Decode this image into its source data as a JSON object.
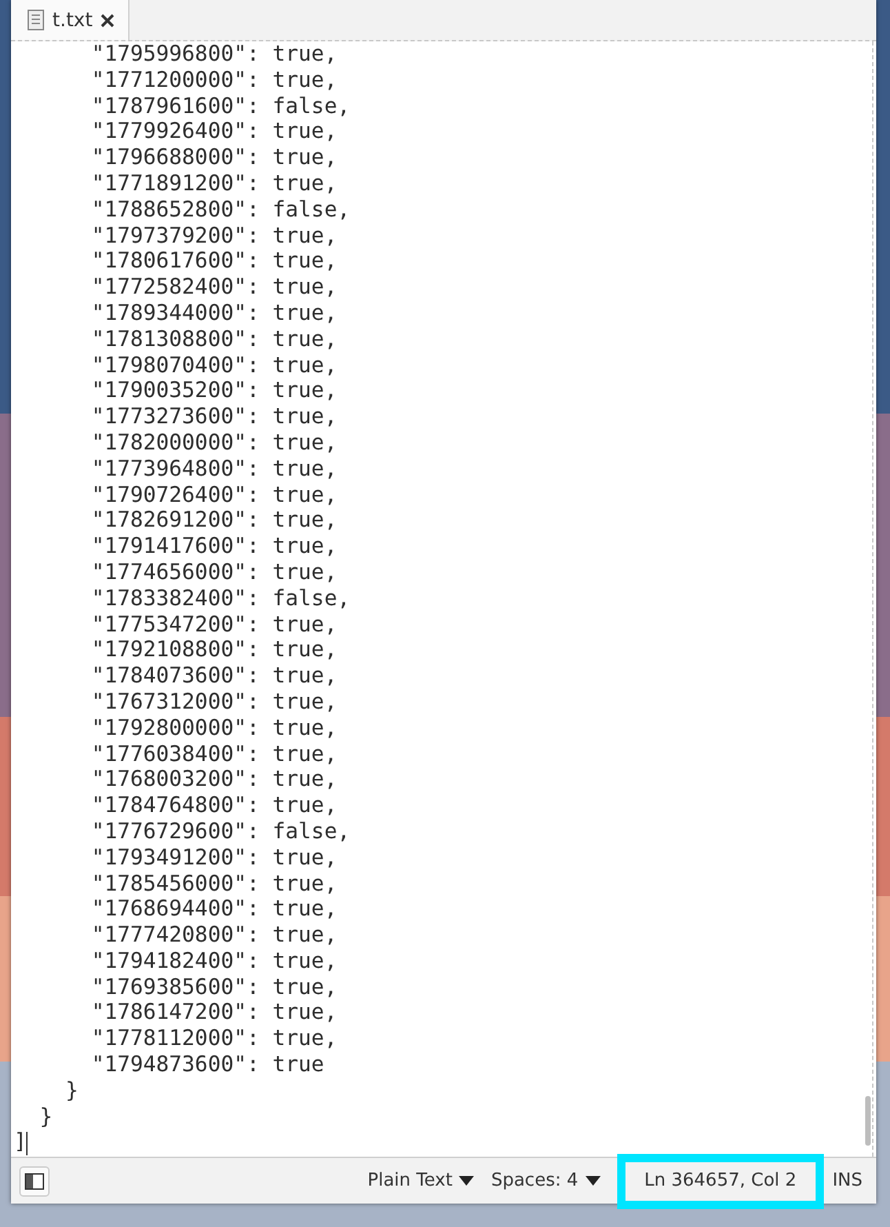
{
  "tab": {
    "title": "t.txt",
    "selected": true
  },
  "editor": {
    "lines": [
      "      \"1795996800\": true,",
      "      \"1771200000\": true,",
      "      \"1787961600\": false,",
      "      \"1779926400\": true,",
      "      \"1796688000\": true,",
      "      \"1771891200\": true,",
      "      \"1788652800\": false,",
      "      \"1797379200\": true,",
      "      \"1780617600\": true,",
      "      \"1772582400\": true,",
      "      \"1789344000\": true,",
      "      \"1781308800\": true,",
      "      \"1798070400\": true,",
      "      \"1790035200\": true,",
      "      \"1773273600\": true,",
      "      \"1782000000\": true,",
      "      \"1773964800\": true,",
      "      \"1790726400\": true,",
      "      \"1782691200\": true,",
      "      \"1791417600\": true,",
      "      \"1774656000\": true,",
      "      \"1783382400\": false,",
      "      \"1775347200\": true,",
      "      \"1792108800\": true,",
      "      \"1784073600\": true,",
      "      \"1767312000\": true,",
      "      \"1792800000\": true,",
      "      \"1776038400\": true,",
      "      \"1768003200\": true,",
      "      \"1784764800\": true,",
      "      \"1776729600\": false,",
      "      \"1793491200\": true,",
      "      \"1785456000\": true,",
      "      \"1768694400\": true,",
      "      \"1777420800\": true,",
      "      \"1794182400\": true,",
      "      \"1769385600\": true,",
      "      \"1786147200\": true,",
      "      \"1778112000\": true,",
      "      \"1794873600\": true",
      "    }",
      "  }",
      "]"
    ]
  },
  "status_bar": {
    "language": "Plain Text",
    "indentation": "Spaces: 4",
    "position": "Ln 364657, Col 2",
    "position_highlighted": true,
    "mode": "INS"
  }
}
